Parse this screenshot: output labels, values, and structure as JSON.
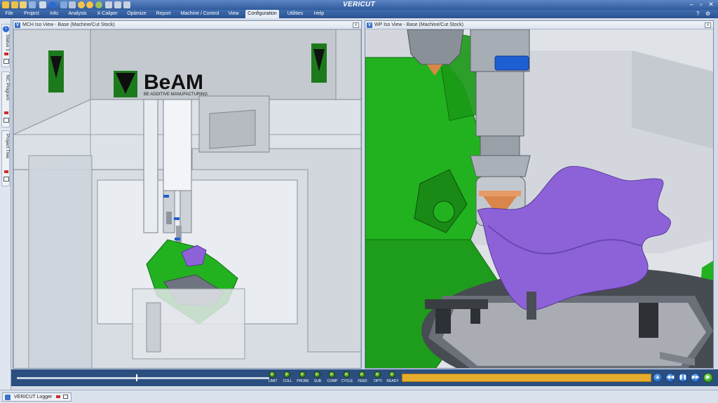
{
  "app": {
    "title": "VERICUT"
  },
  "window_controls": {
    "minimize": "–",
    "maximize": "▫",
    "close": "✕"
  },
  "menubar": {
    "items": [
      {
        "label": "File"
      },
      {
        "label": "Project"
      },
      {
        "label": "Info"
      },
      {
        "label": "Analysis"
      },
      {
        "label": "X-Caliper"
      },
      {
        "label": "Optimize"
      },
      {
        "label": "Report"
      },
      {
        "label": "Machine / Control"
      },
      {
        "label": "View"
      },
      {
        "label": "Configuration"
      },
      {
        "label": "Utilities"
      },
      {
        "label": "Help"
      }
    ],
    "active": "Configuration",
    "right": {
      "help": "?",
      "settings": "⚙"
    }
  },
  "leftdock": {
    "tabs": [
      {
        "label": "Status 1",
        "icon": "info-icon"
      },
      {
        "label": "NC Program"
      },
      {
        "label": "Project Tree"
      }
    ]
  },
  "viewports": [
    {
      "title": "MCH Iso View - Base (Machine/Cut Stock)",
      "close": "x"
    },
    {
      "title": "WP Iso View - Base (Machine/Cut Stock)",
      "close": "x"
    }
  ],
  "scene": {
    "logo_text": "BeAM",
    "logo_tagline": "BE ADDITIVE MANUFACTURING"
  },
  "controlbar": {
    "indicators": [
      "LIMIT",
      "COLL",
      "PROBE",
      "SUB",
      "COMP",
      "CYCLE",
      "FEED",
      "OPTI",
      "READY"
    ],
    "buttons": [
      {
        "name": "rewind-to-start",
        "glyph": "▲"
      },
      {
        "name": "step-back",
        "glyph": "◀◀"
      },
      {
        "name": "pause",
        "glyph": "❚❚"
      },
      {
        "name": "step-forward",
        "glyph": "▶▶"
      },
      {
        "name": "play",
        "glyph": "▶"
      }
    ]
  },
  "status": {
    "logger_tab": "VERICUT Logger"
  },
  "colors": {
    "machine_green": "#22b21f",
    "part_purple": "#8d62d8",
    "progress": "#e6ac2e",
    "titlebar": "#2f5a9c"
  }
}
